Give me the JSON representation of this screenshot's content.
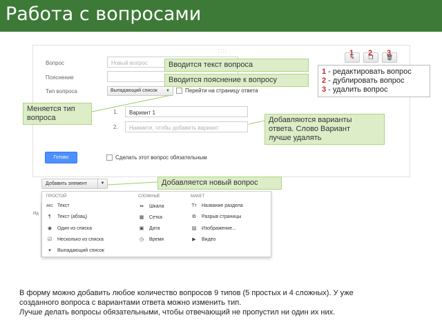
{
  "slide": {
    "title": "Работа с вопросами",
    "caption_lines": [
      "В форму можно добавить любое количество вопросов 9 типов (5 простых и 4 сложных). У уже",
      "созданного вопроса с вариантами ответа можно изменить тип.",
      "Лучше делать вопросы обязательными, чтобы отвечающий не пропустил ни один их них."
    ]
  },
  "form": {
    "grip": "::::",
    "question_label": "Вопрос",
    "question_placeholder": "Новый вопрос",
    "hint_label": "Пояснение",
    "type_label": "Тип вопроса",
    "type_value": "Выпадающий список",
    "goto_page_label": "Перейти на страницу ответа",
    "option_1_num": "1.",
    "option_1_value": "Вариант 1",
    "option_2_num": "2.",
    "option_2_placeholder": "Нажмите, чтобы добавить вариант",
    "done_label": "Готово",
    "required_label": "Сделать этот вопрос обязательным",
    "tools": [
      {
        "number": "1",
        "icon": "pencil-icon",
        "glyph": "✎"
      },
      {
        "number": "2",
        "icon": "duplicate-icon",
        "glyph": "❐"
      },
      {
        "number": "3",
        "icon": "trash-icon",
        "glyph": "🗑"
      }
    ]
  },
  "add_element": {
    "label": "Добавить элемент",
    "strip_text": "Ид"
  },
  "menu": {
    "simple_header": "ПРОСТОЙ",
    "complex_header": "СЛОЖНЫЕ",
    "layout_header": "МАКЕТ",
    "simple": [
      {
        "icon": "abc-icon",
        "glyph": "ABC",
        "label": "Текст"
      },
      {
        "icon": "paragraph-icon",
        "glyph": "¶",
        "label": "Текст (абзац)"
      },
      {
        "icon": "radio-icon",
        "glyph": "◉",
        "label": "Один из списка"
      },
      {
        "icon": "checkbox-icon",
        "glyph": "☑",
        "label": "Несколько из списка"
      },
      {
        "icon": "dropdown-icon",
        "glyph": "▾",
        "label": "Выпадающий список"
      }
    ],
    "complex": [
      {
        "icon": "scale-icon",
        "glyph": "⇹",
        "label": "Шкала"
      },
      {
        "icon": "grid-icon",
        "glyph": "▦",
        "label": "Сетка"
      },
      {
        "icon": "calendar-icon",
        "glyph": "▣",
        "label": "Дата"
      },
      {
        "icon": "clock-icon",
        "glyph": "◷",
        "label": "Время"
      }
    ],
    "layout": [
      {
        "icon": "section-title-icon",
        "glyph": "Tт",
        "label": "Название раздела"
      },
      {
        "icon": "page-break-icon",
        "glyph": "⧉",
        "label": "Разрыв страницы"
      },
      {
        "icon": "image-icon",
        "glyph": "▨",
        "label": "Изображение..."
      },
      {
        "icon": "video-icon",
        "glyph": "▶",
        "label": "Видео"
      }
    ]
  },
  "callouts": {
    "question_text": "Вводится текст вопроса",
    "hint_text": "Вводится пояснение к вопросу",
    "type_change": [
      "Меняется тип",
      "вопроса"
    ],
    "options": [
      "Добавляются варианты",
      "ответа. Слово Вариант",
      "лучше удалять"
    ],
    "new_question": "Добавляется новый вопрос",
    "tools_legend": [
      {
        "num": "1",
        "text": " - редактировать вопрос"
      },
      {
        "num": "2",
        "text": " - дублировать вопрос"
      },
      {
        "num": "3",
        "text": " - удалить вопрос"
      }
    ]
  },
  "colors": {
    "title_bar": "#3e7a37",
    "callout_fill": "#dcedc8",
    "number_red": "#c62828",
    "button_blue": "#4d90fe"
  }
}
